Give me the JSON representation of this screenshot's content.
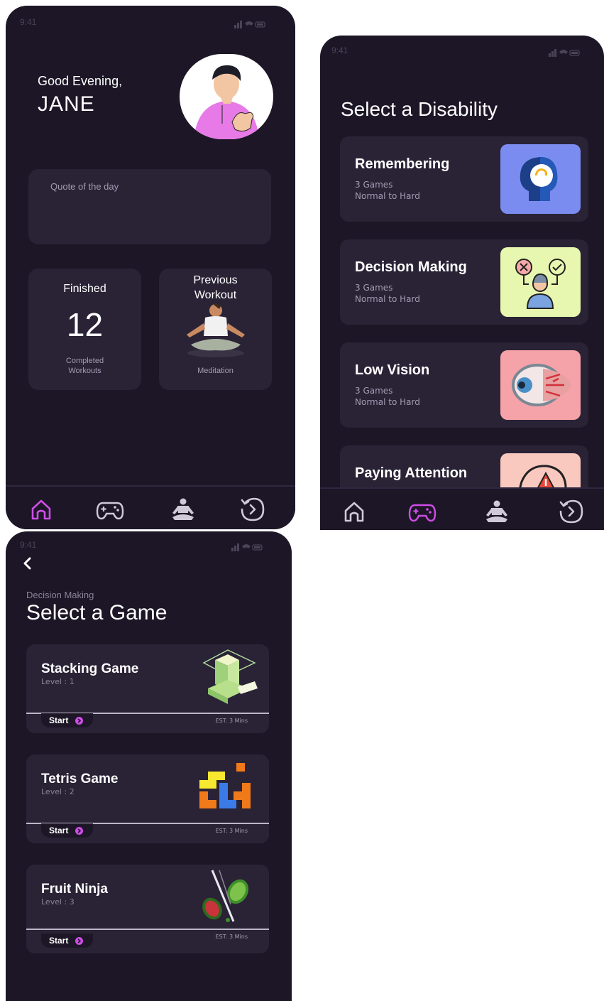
{
  "status_bar": {
    "time": "9:41"
  },
  "home": {
    "greeting": "Good Evening,",
    "user_name": "JANE",
    "quote_label": "Quote of the day",
    "finished_title": "Finished",
    "finished_count": "12",
    "finished_caption_1": "Completed",
    "finished_caption_2": "Workouts",
    "previous_title_1": "Previous",
    "previous_title_2": "Workout",
    "previous_caption": "Meditation"
  },
  "disability": {
    "title": "Select a Disability",
    "items": [
      {
        "title": "Remembering",
        "games": "3 Games",
        "level": "Normal to Hard",
        "icon": "brain-memory-icon",
        "color": "#7b8cf0"
      },
      {
        "title": "Decision Making",
        "games": "3 Games",
        "level": "Normal to Hard",
        "icon": "decision-person-icon",
        "color": "#e8f7b0"
      },
      {
        "title": "Low Vision",
        "games": "3 Games",
        "level": "Normal to Hard",
        "icon": "eye-icon",
        "color": "#f5a3a8"
      },
      {
        "title": "Paying Attention",
        "games": "",
        "level": "",
        "icon": "attention-head-icon",
        "color": "#f9c9c0"
      }
    ]
  },
  "games": {
    "breadcrumb": "Decision Making",
    "title": "Select a Game",
    "items": [
      {
        "title": "Stacking Game",
        "level": "Level : 1",
        "start": "Start",
        "est": "EST: 3 Mins",
        "icon": "stacking-blocks-icon"
      },
      {
        "title": "Tetris Game",
        "level": "Level : 2",
        "start": "Start",
        "est": "EST: 3 Mins",
        "icon": "tetris-blocks-icon"
      },
      {
        "title": "Fruit Ninja",
        "level": "Level : 3",
        "start": "Start",
        "est": "EST: 3 Mins",
        "icon": "fruit-slice-icon"
      }
    ]
  },
  "nav": {
    "items": [
      "home-icon",
      "gamepad-icon",
      "meditation-icon",
      "history-icon"
    ],
    "active_color": "#d04ce8",
    "inactive_color": "#cfcad8"
  },
  "colors": {
    "background": "#1c1626",
    "card": "#2a2336",
    "accent": "#d04ce8"
  }
}
